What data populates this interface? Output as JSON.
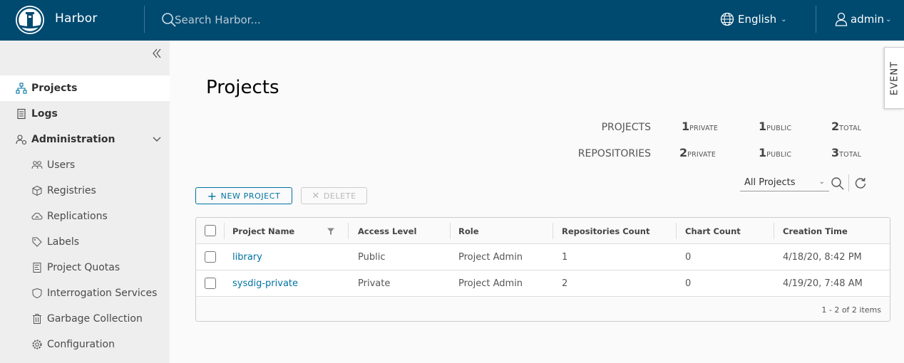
{
  "header": {
    "app_title": "Harbor",
    "search_placeholder": "Search Harbor...",
    "language": "English",
    "user": "admin",
    "bg_color": "#004a70"
  },
  "sidebar": {
    "items": [
      {
        "label": "Projects",
        "icon": "projects-icon",
        "active": true
      },
      {
        "label": "Logs",
        "icon": "logs-icon"
      },
      {
        "label": "Administration",
        "icon": "administration-icon",
        "expanded": true
      },
      {
        "label": "Users",
        "icon": "users-icon"
      },
      {
        "label": "Registries",
        "icon": "registries-icon"
      },
      {
        "label": "Replications",
        "icon": "replications-icon"
      },
      {
        "label": "Labels",
        "icon": "labels-icon"
      },
      {
        "label": "Project Quotas",
        "icon": "quotas-icon"
      },
      {
        "label": "Interrogation Services",
        "icon": "shield-icon"
      },
      {
        "label": "Garbage Collection",
        "icon": "trash-icon"
      },
      {
        "label": "Configuration",
        "icon": "gear-icon"
      }
    ]
  },
  "event_tab": "EVENT",
  "main": {
    "title": "Projects",
    "stats": {
      "projects_label": "PROJECTS",
      "repositories_label": "REPOSITORIES",
      "projects": {
        "private": "1",
        "public": "1",
        "total": "2"
      },
      "repositories": {
        "private": "2",
        "public": "1",
        "total": "3"
      },
      "private_label": "PRIVATE",
      "public_label": "PUBLIC",
      "total_label": "TOTAL"
    },
    "new_project_label": "NEW PROJECT",
    "delete_label": "DELETE",
    "filter_select": "All Projects",
    "table": {
      "columns": [
        "Project Name",
        "Access Level",
        "Role",
        "Repositories Count",
        "Chart Count",
        "Creation Time"
      ],
      "rows": [
        [
          "library",
          "Public",
          "Project Admin",
          "1",
          "0",
          "4/18/20, 8:42 PM"
        ],
        [
          "sysdig-private",
          "Private",
          "Project Admin",
          "2",
          "0",
          "4/19/20, 7:48 AM"
        ]
      ],
      "footer": "1 - 2 of 2 items"
    }
  },
  "accent_color": "#0072a3"
}
